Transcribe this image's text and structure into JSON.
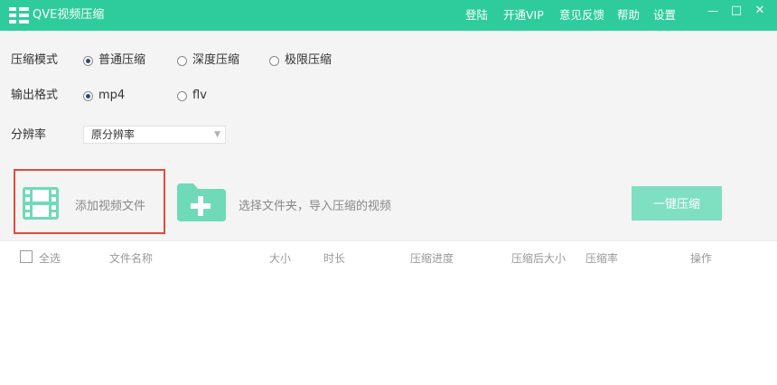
{
  "titlebar": {
    "app_title": "QVE视频压缩",
    "menu": [
      "登陆",
      "开通VIP",
      "意见反馈",
      "帮助",
      "设置"
    ],
    "window_buttons": {
      "minimize": "—",
      "maximize": "□",
      "close": "✕"
    }
  },
  "compression_mode": {
    "label": "压缩模式",
    "options": [
      "普通压缩",
      "深度压缩",
      "极限压缩"
    ],
    "selected": "普通压缩"
  },
  "output_format": {
    "label": "输出格式",
    "options": [
      "mp4",
      "flv"
    ],
    "selected": "mp4"
  },
  "resolution": {
    "label": "分辨率",
    "selected": "原分辨率",
    "arrow": "▼"
  },
  "actions": {
    "add_video": "添加视频文件",
    "select_folder": "选择文件夹，导入压缩的视频",
    "one_click_compress": "一键压缩"
  },
  "table": {
    "select_all": "全选",
    "columns": [
      "文件名称",
      "大小",
      "时长",
      "压缩进度",
      "压缩后大小",
      "压缩率",
      "操作"
    ]
  },
  "colors": {
    "brand": "#2ecc9c",
    "button_light": "#7fdfc1",
    "highlight_box": "#e04a3f",
    "icon_green": "#6fdab8"
  }
}
